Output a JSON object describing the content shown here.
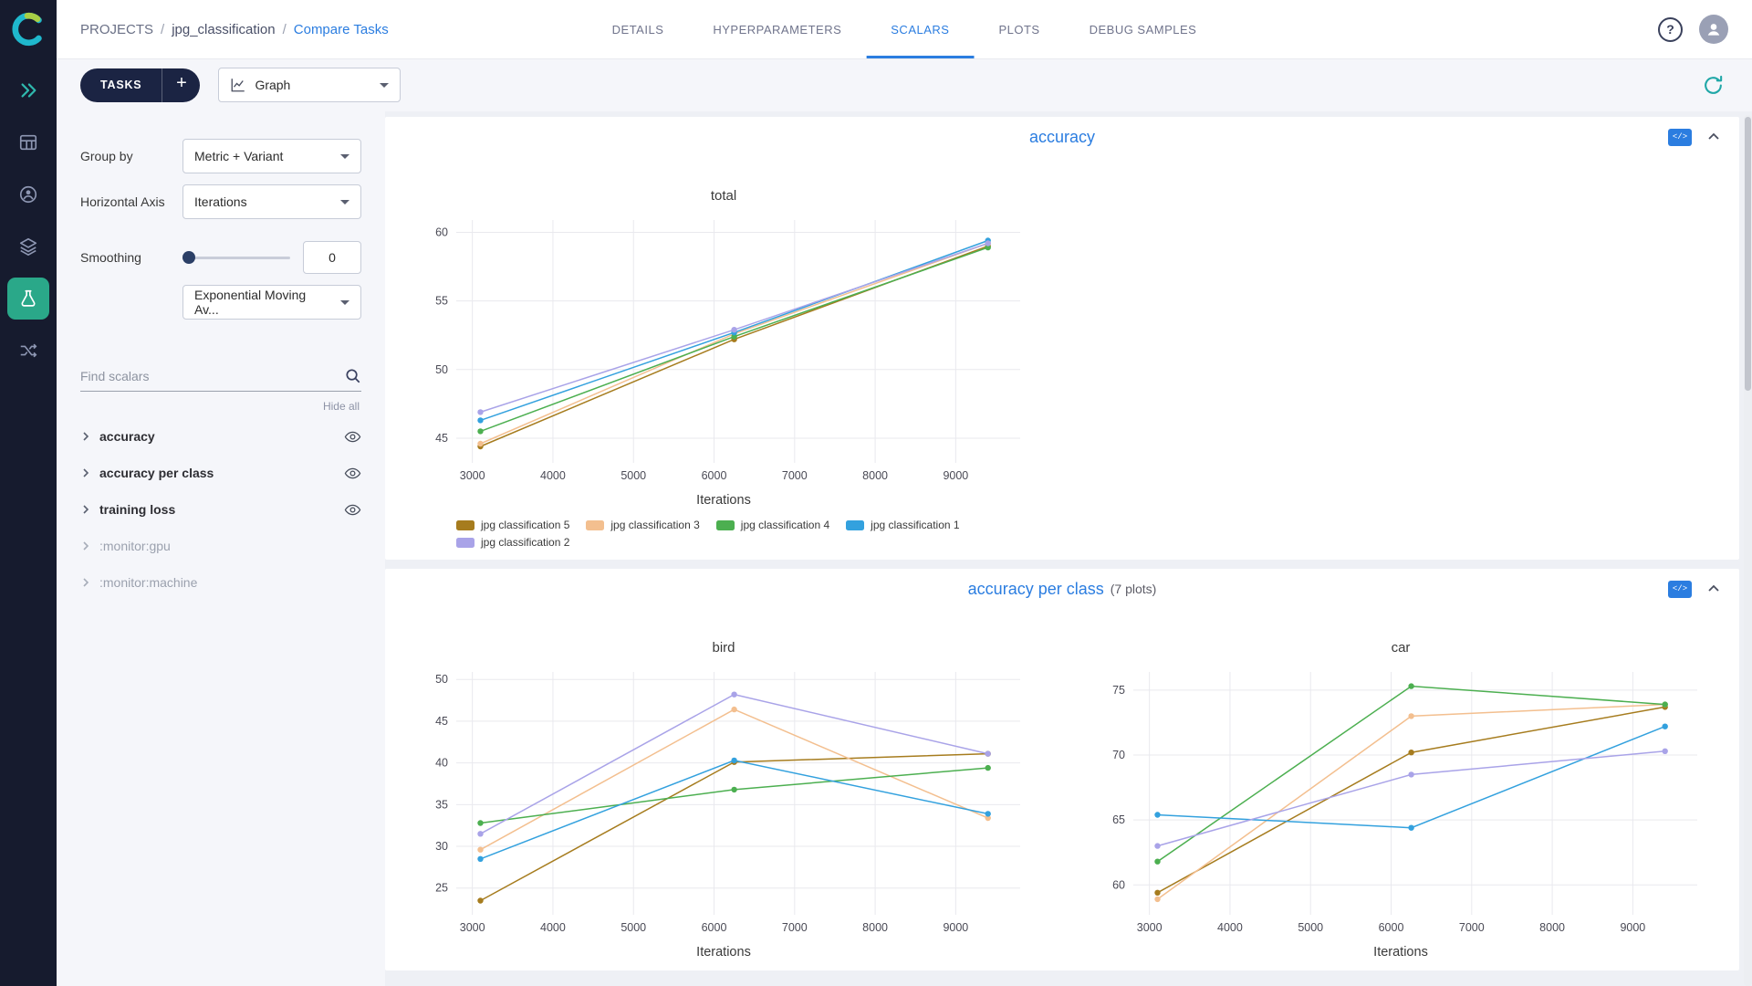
{
  "colors": {
    "accent_blue": "#2b7de0",
    "rail_bg": "#161b2e",
    "rail_active_bg": "#2aa889",
    "panel_bg": "#f5f6fa",
    "navy_button": "#1b2443",
    "teal_icon": "#1fa7a7"
  },
  "header": {
    "breadcrumb": [
      "PROJECTS",
      "jpg_classification",
      "Compare Tasks"
    ],
    "breadcrumb_separator": "/",
    "help_symbol": "?",
    "tabs": [
      {
        "label": "DETAILS",
        "active": false
      },
      {
        "label": "HYPERPARAMETERS",
        "active": false
      },
      {
        "label": "SCALARS",
        "active": true
      },
      {
        "label": "PLOTS",
        "active": false
      },
      {
        "label": "DEBUG SAMPLES",
        "active": false
      }
    ]
  },
  "toolbar": {
    "tasks_label": "TASKS",
    "add_label": "+",
    "view_mode": "Graph"
  },
  "controls": {
    "group_by_label": "Group by",
    "group_by_value": "Metric + Variant",
    "haxis_label": "Horizontal Axis",
    "haxis_value": "Iterations",
    "smoothing_label": "Smoothing",
    "smoothing_value": "0",
    "smoothing_type": "Exponential Moving Av...",
    "search_placeholder": "Find scalars",
    "hide_all_label": "Hide all"
  },
  "scalars_list": [
    {
      "label": "accuracy",
      "muted": false,
      "eye": true
    },
    {
      "label": "accuracy per class",
      "muted": false,
      "eye": true
    },
    {
      "label": "training loss",
      "muted": false,
      "eye": true
    },
    {
      "label": ":monitor:gpu",
      "muted": true,
      "eye": false
    },
    {
      "label": ":monitor:machine",
      "muted": true,
      "eye": false
    }
  ],
  "sections": [
    {
      "title": "accuracy",
      "subtitle": ""
    },
    {
      "title": "accuracy per class",
      "subtitle": "(7 plots)"
    }
  ],
  "chart_data": [
    {
      "type": "line",
      "title": "total",
      "xlabel": "Iterations",
      "x": [
        3100,
        6250,
        9400
      ],
      "xticks": [
        3000,
        4000,
        5000,
        6000,
        7000,
        8000,
        9000
      ],
      "xlim": [
        2800,
        9800
      ],
      "ylim": [
        43.2,
        60.9
      ],
      "yticks": [
        45,
        50,
        55,
        60
      ],
      "grid": true,
      "legend_position": "bottom-left",
      "series": [
        {
          "name": "jpg classification 5",
          "color": "#a67c1e",
          "values": [
            44.4,
            52.2,
            59.0
          ]
        },
        {
          "name": "jpg classification 3",
          "color": "#f3bf8f",
          "values": [
            44.6,
            52.6,
            59.2
          ]
        },
        {
          "name": "jpg classification 4",
          "color": "#4caf50",
          "values": [
            45.5,
            52.4,
            58.9
          ]
        },
        {
          "name": "jpg classification 1",
          "color": "#33a1de",
          "values": [
            46.3,
            52.7,
            59.4
          ]
        },
        {
          "name": "jpg classification 2",
          "color": "#a9a3e8",
          "values": [
            46.9,
            52.9,
            59.2
          ]
        }
      ]
    },
    {
      "type": "line",
      "title": "bird",
      "xlabel": "Iterations",
      "x": [
        3100,
        6250,
        9400
      ],
      "xticks": [
        3000,
        4000,
        5000,
        6000,
        7000,
        8000,
        9000
      ],
      "xlim": [
        2800,
        9800
      ],
      "ylim": [
        21.8,
        50.9
      ],
      "yticks": [
        25,
        30,
        35,
        40,
        45,
        50
      ],
      "grid": true,
      "series": [
        {
          "name": "jpg classification 5",
          "color": "#a67c1e",
          "values": [
            23.5,
            40.1,
            41.1
          ]
        },
        {
          "name": "jpg classification 3",
          "color": "#f3bf8f",
          "values": [
            29.6,
            46.4,
            33.4
          ]
        },
        {
          "name": "jpg classification 4",
          "color": "#4caf50",
          "values": [
            32.8,
            36.8,
            39.4
          ]
        },
        {
          "name": "jpg classification 1",
          "color": "#33a1de",
          "values": [
            28.5,
            40.3,
            33.9
          ]
        },
        {
          "name": "jpg classification 2",
          "color": "#a9a3e8",
          "values": [
            31.5,
            48.2,
            41.1
          ]
        }
      ]
    },
    {
      "type": "line",
      "title": "car",
      "xlabel": "Iterations",
      "x": [
        3100,
        6250,
        9400
      ],
      "xticks": [
        3000,
        4000,
        5000,
        6000,
        7000,
        8000,
        9000
      ],
      "xlim": [
        2800,
        9800
      ],
      "ylim": [
        57.7,
        76.4
      ],
      "yticks": [
        60,
        65,
        70,
        75
      ],
      "grid": true,
      "series": [
        {
          "name": "jpg classification 5",
          "color": "#a67c1e",
          "values": [
            59.4,
            70.2,
            73.7
          ]
        },
        {
          "name": "jpg classification 3",
          "color": "#f3bf8f",
          "values": [
            58.9,
            73.0,
            73.9
          ]
        },
        {
          "name": "jpg classification 4",
          "color": "#4caf50",
          "values": [
            61.8,
            75.3,
            73.9
          ]
        },
        {
          "name": "jpg classification 1",
          "color": "#33a1de",
          "values": [
            65.4,
            64.4,
            72.2
          ]
        },
        {
          "name": "jpg classification 2",
          "color": "#a9a3e8",
          "values": [
            63.0,
            68.5,
            70.3
          ]
        }
      ]
    }
  ]
}
